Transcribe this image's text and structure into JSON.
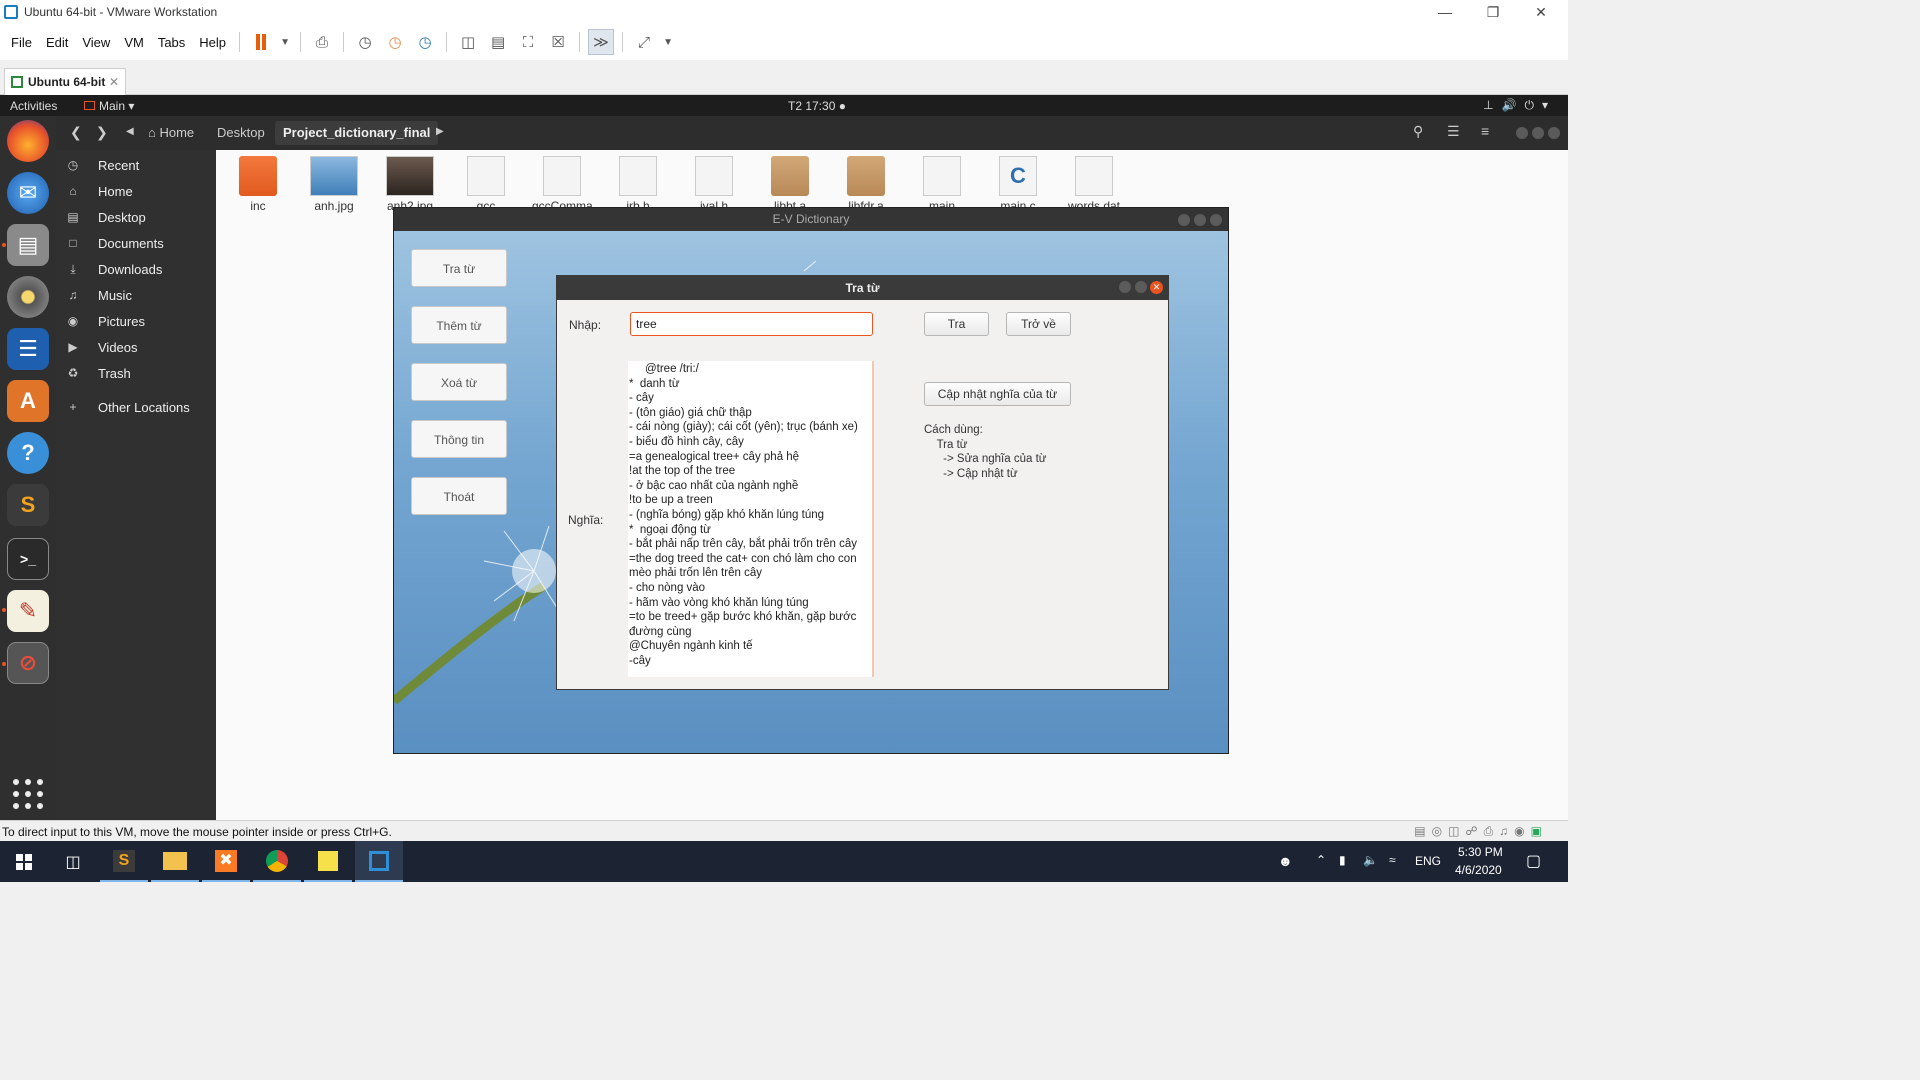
{
  "vm_window": {
    "title": "Ubuntu 64-bit - VMware Workstation",
    "menu": [
      "File",
      "Edit",
      "View",
      "VM",
      "Tabs",
      "Help"
    ],
    "tab_label": "Ubuntu 64-bit",
    "status_text": "To direct input to this VM, move the mouse pointer inside or press Ctrl+G."
  },
  "ubuntu_topbar": {
    "activities": "Activities",
    "app_menu": "Main",
    "clock": "T2 17:30"
  },
  "nautilus": {
    "breadcrumbs": [
      "Home",
      "Desktop",
      "Project_dictionary_final"
    ],
    "sidebar": [
      {
        "label": "Recent",
        "icon": "clock-icon"
      },
      {
        "label": "Home",
        "icon": "home-icon"
      },
      {
        "label": "Desktop",
        "icon": "folder-icon"
      },
      {
        "label": "Documents",
        "icon": "document-icon"
      },
      {
        "label": "Downloads",
        "icon": "download-icon"
      },
      {
        "label": "Music",
        "icon": "music-icon"
      },
      {
        "label": "Pictures",
        "icon": "camera-icon"
      },
      {
        "label": "Videos",
        "icon": "video-icon"
      },
      {
        "label": "Trash",
        "icon": "trash-icon"
      },
      {
        "label": "Other Locations",
        "icon": "plus-icon"
      }
    ],
    "files": [
      {
        "name": "inc",
        "kind": "folder"
      },
      {
        "name": "anh.jpg",
        "kind": "image"
      },
      {
        "name": "anh2.jpg",
        "kind": "photo"
      },
      {
        "name": "gcc",
        "kind": "doc"
      },
      {
        "name": "gccComma",
        "kind": "doc"
      },
      {
        "name": "irb.h",
        "kind": "doc"
      },
      {
        "name": "ival.h",
        "kind": "doc"
      },
      {
        "name": "libbt.a",
        "kind": "archive"
      },
      {
        "name": "libfdr.a",
        "kind": "archive"
      },
      {
        "name": "main",
        "kind": "doc"
      },
      {
        "name": "main.c",
        "kind": "c-source"
      },
      {
        "name": "words.dat",
        "kind": "doc"
      }
    ]
  },
  "ev_dictionary": {
    "title": "E-V Dictionary",
    "buttons": [
      "Tra từ",
      "Thêm từ",
      "Xoá từ",
      "Thông tin",
      "Thoát"
    ]
  },
  "tra_tu_dialog": {
    "title": "Tra từ",
    "input_label": "Nhập:",
    "input_value": "tree",
    "meaning_label": "Nghĩa:",
    "search_button": "Tra",
    "back_button": "Trở về",
    "update_button": "Cập nhật nghĩa của từ",
    "usage_text": "Cách dùng:\n    Tra từ\n      -> Sửa nghĩa của từ\n      -> Cập nhật từ",
    "meaning_text": "     @tree /tri:/\n*  danh từ\n- cây\n- (tôn giáo) giá chữ thập\n- cái nòng (giày); cái cốt (yên); trục (bánh xe)\n- biểu đồ hình cây, cây\n=a genealogical tree+ cây phả hệ\n!at the top of the tree\n- ở bậc cao nhất của ngành nghề\n!to be up a treen\n- (nghĩa bóng) gặp khó khăn lúng túng\n*  ngoại động từ\n- bắt phải nấp trên cây, bắt phải trốn trên cây\n=the dog treed the cat+ con chó làm cho con mèo phải trốn lên trên cây\n- cho nòng vào\n- hãm vào vòng khó khăn lúng túng\n=to be treed+ gặp bước khó khăn, gặp bước đường cùng\n@Chuyên ngành kinh tế\n-cây"
  },
  "windows_taskbar": {
    "language": "ENG",
    "time": "5:30 PM",
    "date": "4/6/2020"
  },
  "colors": {
    "ubuntu_orange": "#e95420",
    "dark_header": "#2d2d2d",
    "taskbar": "#1c2332"
  }
}
